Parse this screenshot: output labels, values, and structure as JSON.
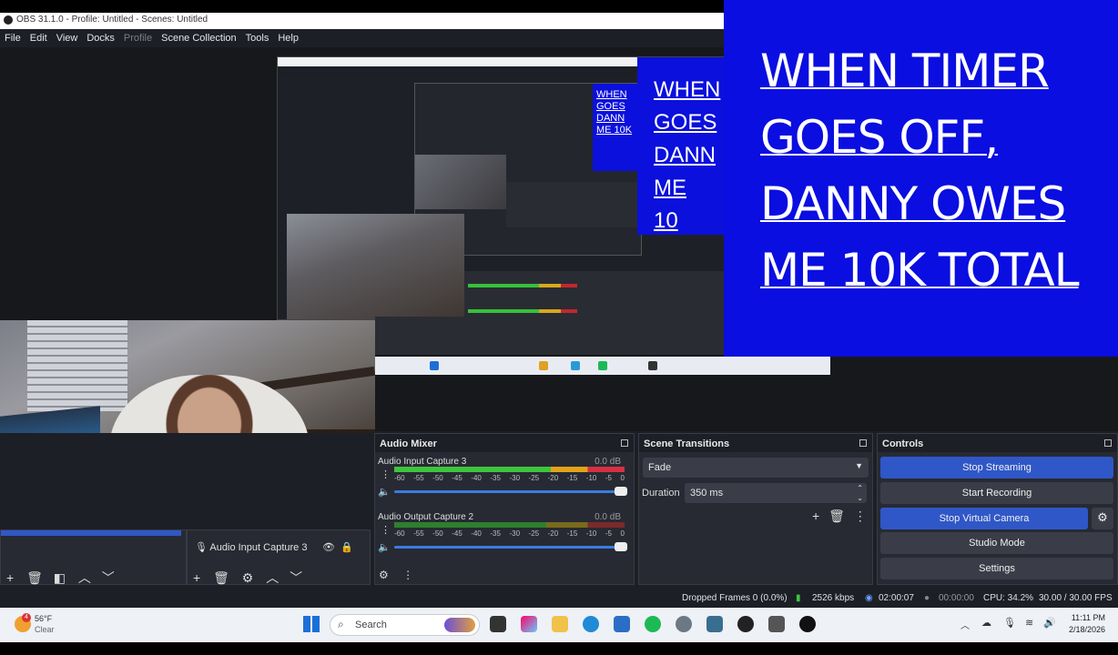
{
  "window": {
    "title": "OBS 31.1.0 - Profile: Untitled - Scenes: Untitled"
  },
  "menu": [
    "File",
    "Edit",
    "View",
    "Docks",
    "Profile",
    "Scene Collection",
    "Tools",
    "Help"
  ],
  "menu_disabled": "Profile",
  "banner": {
    "lines": [
      "WHEN TIMER",
      "GOES OFF,",
      "DANNY OWES",
      "ME 10K TOTAL"
    ],
    "nested_large": [
      "WHEN",
      "GOES",
      "DANN",
      "ME 10"
    ],
    "nested_small": [
      "WHEN",
      "GOES",
      "DANN",
      "ME 10K"
    ]
  },
  "sources": {
    "audio_input_item": "Audio Input Capture 3"
  },
  "audio_mixer": {
    "title": "Audio Mixer",
    "ticks": [
      "-60",
      "-55",
      "-50",
      "-45",
      "-40",
      "-35",
      "-30",
      "-25",
      "-20",
      "-15",
      "-10",
      "-5",
      "0"
    ],
    "channels": [
      {
        "name": "Audio Input Capture 3",
        "db": "0.0 dB"
      },
      {
        "name": "Audio Output Capture 2",
        "db": "0.0 dB"
      }
    ]
  },
  "scene_transitions": {
    "title": "Scene Transitions",
    "transition": "Fade",
    "duration_label": "Duration",
    "duration_value": "350 ms"
  },
  "controls": {
    "title": "Controls",
    "stop_streaming": "Stop Streaming",
    "start_recording": "Start Recording",
    "stop_virtual_camera": "Stop Virtual Camera",
    "studio_mode": "Studio Mode",
    "settings": "Settings"
  },
  "status": {
    "dropped_frames": "Dropped Frames 0 (0.0%)",
    "bitrate": "2526 kbps",
    "stream_time": "02:00:07",
    "record_time": "00:00:00",
    "cpu": "CPU: 34.2%",
    "fps": "30.00 / 30.00 FPS"
  },
  "taskbar": {
    "weather_temp": "56°F",
    "weather_cond": "Clear",
    "weather_badge": "4",
    "search_placeholder": "Search",
    "time": "11:11 PM",
    "date": "2/18/2026"
  },
  "colors": {
    "banner_blue": "#0a0ee0",
    "button_blue": "#2f57c7",
    "obs_bg": "#1d1f26"
  }
}
